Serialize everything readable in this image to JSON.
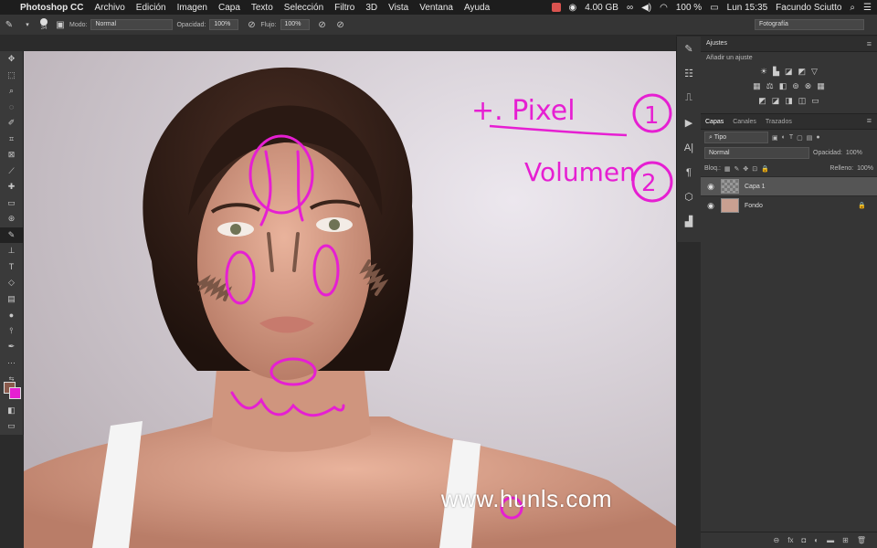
{
  "menubar": {
    "app_name": "Photoshop CC",
    "menus": [
      "Archivo",
      "Edición",
      "Imagen",
      "Capa",
      "Texto",
      "Selección",
      "Filtro",
      "3D",
      "Vista",
      "Ventana",
      "Ayuda"
    ],
    "memory": "4.00 GB",
    "battery": "100 %",
    "clock": "Lun 15:35",
    "user": "Facundo Sciutto"
  },
  "options": {
    "brush_size": "34",
    "mode_label": "Modo:",
    "mode_value": "Normal",
    "opacity_label": "Opacidad:",
    "opacity_value": "100%",
    "flow_label": "Flujo:",
    "flow_value": "100%",
    "workspace": "Fotografía"
  },
  "adjustments": {
    "title": "Ajustes",
    "subtitle": "Añadir un ajuste"
  },
  "layers_panel": {
    "tabs": [
      "Capas",
      "Canales",
      "Trazados"
    ],
    "filter_label": "Tipo",
    "blend_mode": "Normal",
    "opacity_label": "Opacidad:",
    "opacity_value": "100%",
    "lock_label": "Bloq.:",
    "fill_label": "Relleno:",
    "fill_value": "100%",
    "layers": [
      {
        "name": "Capa 1",
        "active": true
      },
      {
        "name": "Fondo",
        "active": false
      }
    ]
  },
  "annotations": {
    "line1": "+. Pixel",
    "num1": "1",
    "line2": "Volumen",
    "num2": "2"
  },
  "watermark": "www.hunls.com",
  "colors": {
    "annotation": "#e61fd2",
    "foreground": "#8a5a4c",
    "background": "#e61fd2"
  },
  "icons": {
    "tools": [
      "move-icon",
      "marquee-icon",
      "lasso-icon",
      "quick-select-icon",
      "crop-icon",
      "eyedropper-icon",
      "healing-icon",
      "brush-icon",
      "clone-stamp-icon",
      "history-brush-icon",
      "eraser-icon",
      "gradient-icon",
      "blur-icon",
      "dodge-icon",
      "pen-icon",
      "type-icon",
      "path-select-icon",
      "shape-icon",
      "hand-icon",
      "zoom-icon"
    ]
  }
}
